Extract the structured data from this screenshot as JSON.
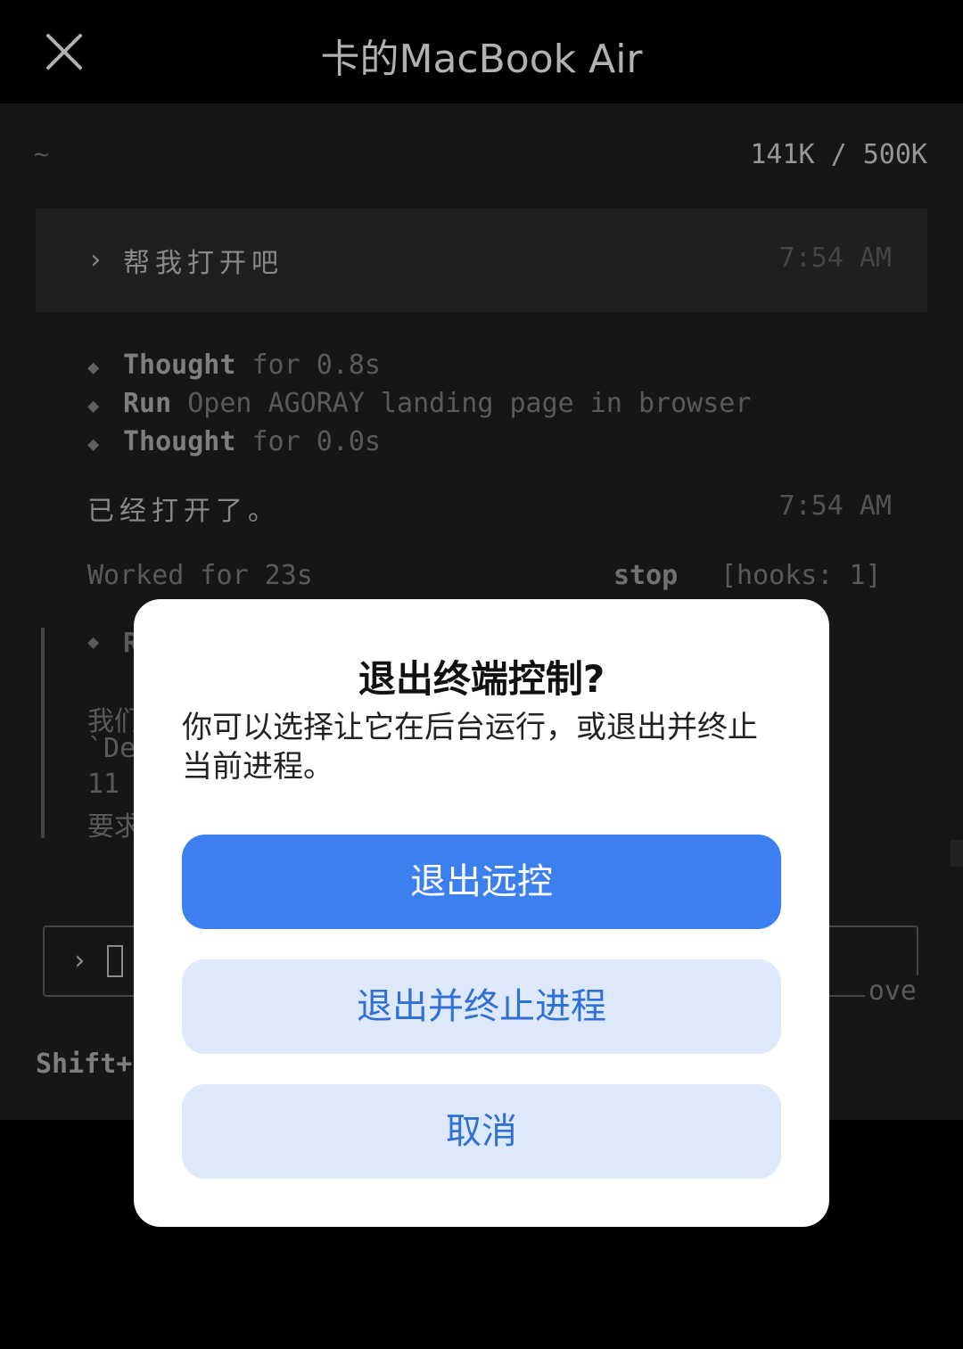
{
  "header": {
    "title": "卡的MacBook Air",
    "close_icon": "close-icon"
  },
  "terminal": {
    "cwd": "~",
    "tokens": "141K / 500K",
    "prompt": {
      "chevron": "›",
      "text": "帮我打开吧",
      "time": "7:54 AM"
    },
    "steps": [
      {
        "marker": "◆",
        "keyword": "Thought",
        "rest": " for 0.8s"
      },
      {
        "marker": "◆",
        "keyword": "Run",
        "rest": " Open AGORAY landing page in browser"
      },
      {
        "marker": "◆",
        "keyword": "Thought",
        "rest": " for 0.0s"
      }
    ],
    "reply": {
      "text": "已经打开了。",
      "time": "7:54 AM"
    },
    "status": {
      "worked": "Worked for 23s",
      "stop": "stop",
      "hooks": "[hooks: 1]"
    },
    "partial": {
      "step_marker": "◆",
      "step_letter": "R",
      "line1": "我们",
      "line2": "`De",
      "line3": "11",
      "line4": "要求"
    },
    "input": {
      "chevron": "›",
      "hint": "ove"
    },
    "shortcut_hint": "Shift+"
  },
  "dialog": {
    "title": "退出终端控制?",
    "message": "你可以选择让它在后台运行，或退出并终止当前进程。",
    "buttons": {
      "exit_remote": "退出远控",
      "exit_kill": "退出并终止进程",
      "cancel": "取消"
    }
  },
  "colors": {
    "primary": "#3b80ee",
    "secondary_bg": "#dde8fa",
    "secondary_text": "#2f6fd6",
    "terminal_bg": "#1c1c1c"
  }
}
